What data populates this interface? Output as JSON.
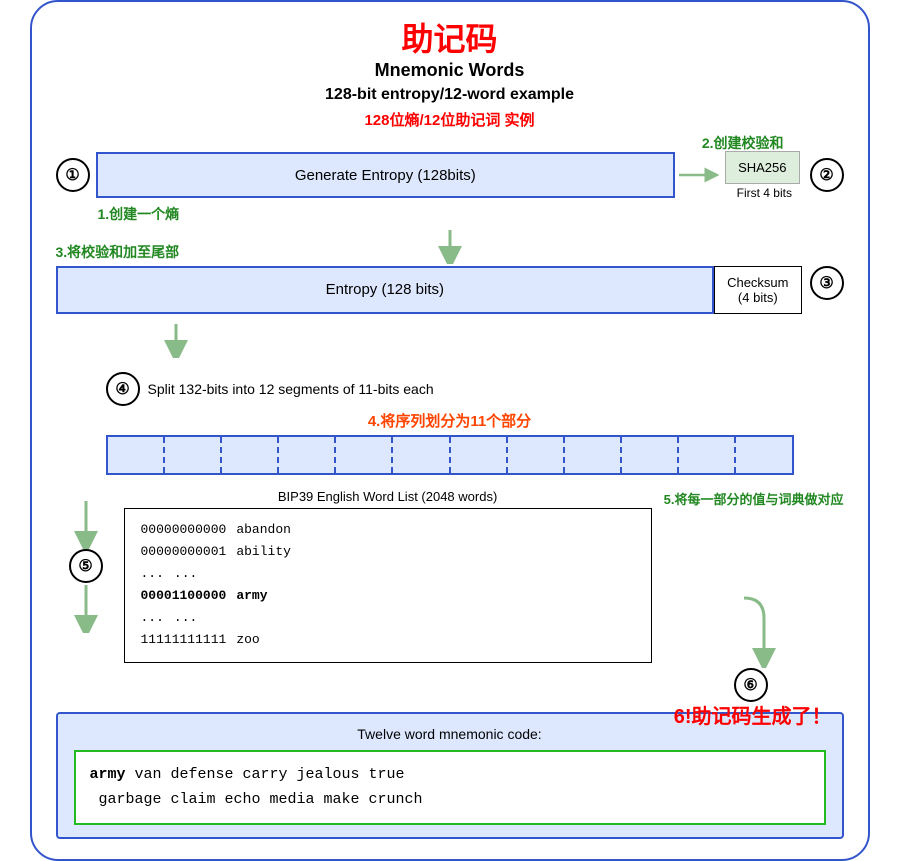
{
  "title": {
    "cn": "助记码",
    "en1": "Mnemonic Words",
    "en2": "128-bit entropy/12-word example",
    "subtitle_cn": "128位熵/12位助记词 实例"
  },
  "step2_label": "2.创建校验和",
  "step1_label": "1.创建一个熵",
  "step3_label": "3.将校验和加至尾部",
  "step4_label": "4.将序列划分为11个部分",
  "step5_label": "5.将每一部分的值与词典做对应",
  "step6_label": "6!助记码生成了！",
  "entropy_box": "Generate Entropy (128bits)",
  "sha_box": "SHA256",
  "first4bits": "First 4 bits",
  "entropy_box2": "Entropy (128 bits)",
  "checksum_box": "Checksum\n(4 bits)",
  "split_desc": "Split 132-bits into 12 segments of 11-bits each",
  "wordlist_title": "BIP39 English Word List (2048 words)",
  "wordlist": [
    {
      "binary": "00000000000",
      "word": "abandon"
    },
    {
      "binary": "00000000001",
      "word": "ability"
    },
    {
      "binary": "...",
      "word": "..."
    },
    {
      "binary": "00001100000",
      "word": "army",
      "bold": true
    },
    {
      "binary": "...",
      "word": "..."
    },
    {
      "binary": "11111111111",
      "word": "zoo"
    }
  ],
  "mnemonic_label": "Twelve word mnemonic code:",
  "mnemonic_words": "army van defense carry jealous true garbage claim echo media make crunch",
  "mnemonic_first": "army",
  "circles": {
    "c1": "①",
    "c2": "②",
    "c3": "③",
    "c4": "④",
    "c5": "⑤",
    "c6": "⑥"
  }
}
